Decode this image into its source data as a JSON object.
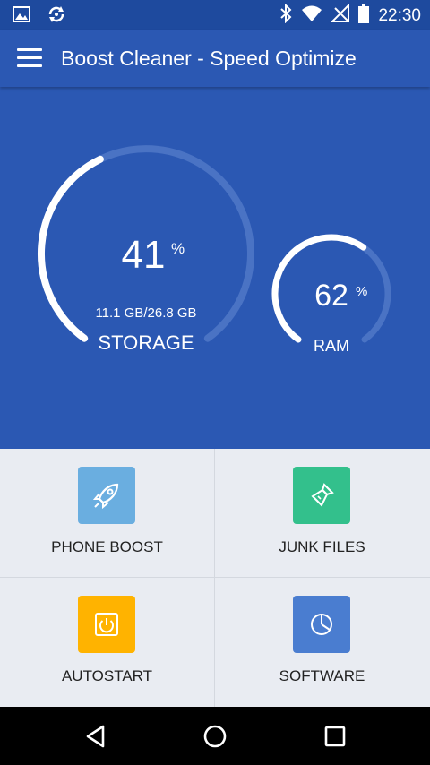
{
  "status_bar": {
    "time": "22:30",
    "left_icons": [
      "image-icon",
      "sync-icon"
    ],
    "right_icons": [
      "bluetooth-icon",
      "wifi-icon",
      "no-signal-icon",
      "battery-icon"
    ]
  },
  "app_bar": {
    "title": "Boost Cleaner - Speed Optimize",
    "menu_icon": "hamburger-menu-icon"
  },
  "storage": {
    "value": "41",
    "unit": "%",
    "detail": "11.1 GB/26.8 GB",
    "label": "STORAGE",
    "fraction": 0.41
  },
  "ram": {
    "value": "62",
    "unit": "%",
    "label": "RAM",
    "fraction": 0.62
  },
  "tiles": [
    {
      "label": "PHONE BOOST",
      "icon": "rocket-icon",
      "color": "#6aaee0"
    },
    {
      "label": "JUNK FILES",
      "icon": "broom-icon",
      "color": "#33c08c"
    },
    {
      "label": "AUTOSTART",
      "icon": "power-icon",
      "color": "#ffb300"
    },
    {
      "label": "SOFTWARE",
      "icon": "pie-chart-icon",
      "color": "#4a7dd0"
    }
  ],
  "colors": {
    "primary": "#2b58b3",
    "status_bar": "#1e4a9e",
    "gauge_track": "#4a73c4",
    "gauge_fill": "#ffffff"
  },
  "nav_bar": {
    "buttons": [
      "back-icon",
      "home-icon",
      "recents-icon"
    ]
  }
}
